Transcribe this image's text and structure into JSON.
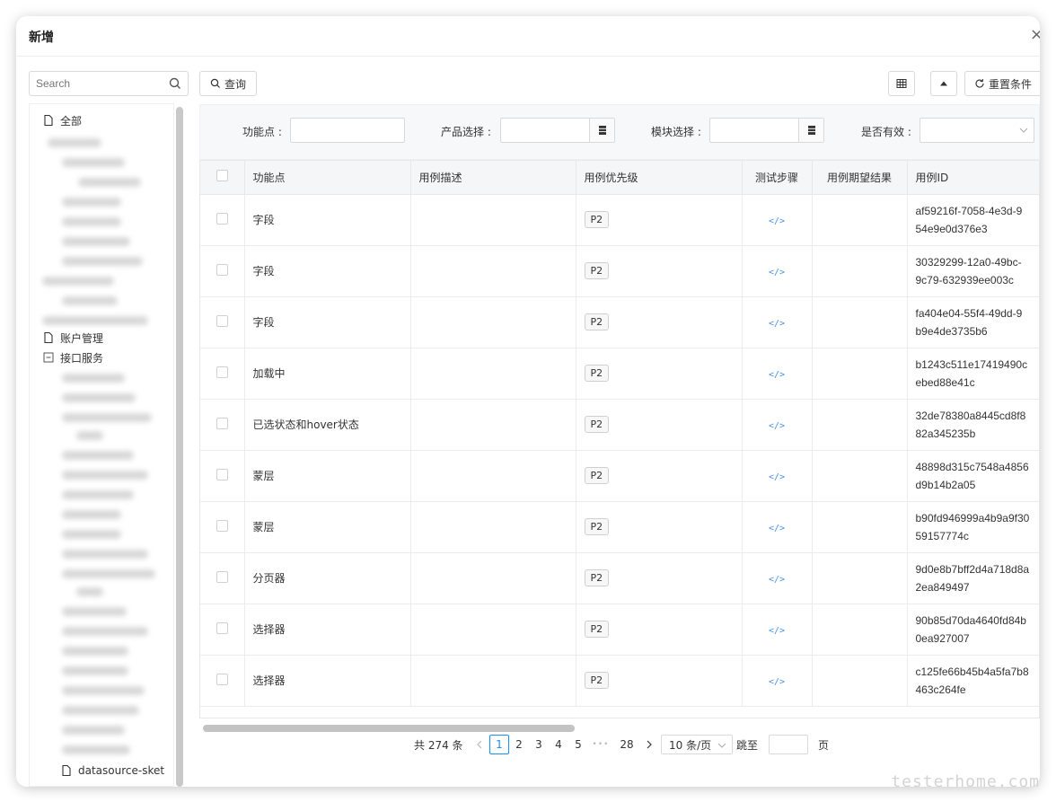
{
  "modal": {
    "title": "新增",
    "close": "×"
  },
  "search": {
    "placeholder": "Search"
  },
  "tree": {
    "all": "全部",
    "account": "账户管理",
    "api": "接口服务",
    "last": "datasource-sket"
  },
  "toolbar": {
    "query": "查询",
    "reset": "重置条件"
  },
  "filters": {
    "feature_label": "功能点 :",
    "product_label": "产品选择 :",
    "module_label": "模块选择 :",
    "valid_label": "是否有效 :"
  },
  "table": {
    "headers": [
      "功能点",
      "用例描述",
      "用例优先级",
      "测试步骤",
      "用例期望结果",
      "用例ID"
    ],
    "rows": [
      {
        "feature": "字段",
        "priority": "P2",
        "id1": "af59216f-7058-4e3d-9",
        "id2": "54e9e0d376e3"
      },
      {
        "feature": "字段",
        "priority": "P2",
        "id1": "30329299-12a0-49bc-",
        "id2": "9c79-632939ee003c"
      },
      {
        "feature": "字段",
        "priority": "P2",
        "id1": "fa404e04-55f4-49dd-9",
        "id2": "b9e4de3735b6"
      },
      {
        "feature": "加载中",
        "priority": "P2",
        "id1": "b1243c511e17419490c",
        "id2": "ebed88e41c"
      },
      {
        "feature": "已选状态和hover状态",
        "priority": "P2",
        "id1": "32de78380a8445cd8f8",
        "id2": "82a345235b"
      },
      {
        "feature": "蒙层",
        "priority": "P2",
        "id1": "48898d315c7548a4856",
        "id2": "d9b14b2a05"
      },
      {
        "feature": "蒙层",
        "priority": "P2",
        "id1": "b90fd946999a4b9a9f30",
        "id2": "59157774c"
      },
      {
        "feature": "分页器",
        "priority": "P2",
        "id1": "9d0e8b7bff2d4a718d8a",
        "id2": "2ea849497"
      },
      {
        "feature": "选择器",
        "priority": "P2",
        "id1": "90b85d70da4640fd84b",
        "id2": "0ea927007"
      },
      {
        "feature": "选择器",
        "priority": "P2",
        "id1": "c125fe66b45b4a5fa7b8",
        "id2": "463c264fe"
      }
    ]
  },
  "pagination": {
    "total": "共 274 条",
    "pages": [
      "1",
      "2",
      "3",
      "4",
      "5",
      "28"
    ],
    "ellipsis": "•••",
    "page_size": "10 条/页",
    "jump_label": "跳至",
    "page_suffix": "页"
  },
  "watermark": "testerhome.com"
}
